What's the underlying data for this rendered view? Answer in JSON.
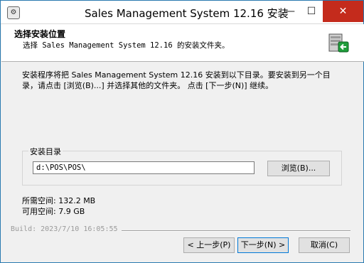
{
  "window": {
    "title": "Sales Management System 12.16 安装",
    "min_glyph": "—",
    "max_glyph": "☐",
    "close_glyph": "✕"
  },
  "header": {
    "title": "选择安装位置",
    "subtitle": "选择 Sales Management System 12.16 的安装文件夹。"
  },
  "intro": {
    "line1": "安装程序将把 Sales Management System 12.16 安装到以下目录。要安装到另一个目",
    "line2": "录，请点击 [浏览(B)...] 并选择其他的文件夹。 点击 [下一步(N)] 继续。"
  },
  "install_dir": {
    "group_label": "安装目录",
    "path_value": "d:\\POS\\POS\\",
    "browse_label": "浏览(B)..."
  },
  "space": {
    "required": "所需空间: 132.2 MB",
    "available": "可用空间: 7.9 GB"
  },
  "footer": {
    "build": "Build: 2023/7/10 16:05:55",
    "back_label": "< 上一步(P)",
    "next_label": "下一步(N) >",
    "cancel_label": "取消(C)"
  },
  "colors": {
    "close_button": "#c42b1c",
    "next_focus_border": "#0078d7"
  },
  "icons": {
    "app": "installer-app-icon",
    "header": "server-install-icon"
  }
}
